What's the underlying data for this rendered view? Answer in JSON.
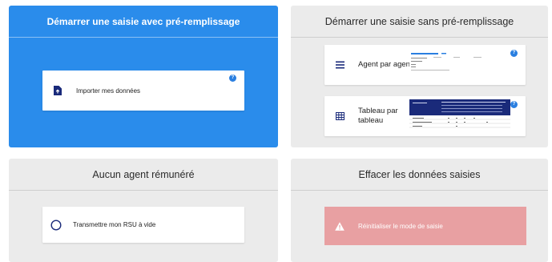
{
  "cards": {
    "with_prefill": {
      "title": "Démarrer une saisie avec pré-remplissage",
      "import_label": "Importer mes données",
      "help": "?"
    },
    "without_prefill": {
      "title": "Démarrer une saisie sans pré-remplissage",
      "agent_label": "Agent par agent",
      "table_label": "Tableau par tableau",
      "help": "?"
    },
    "no_agent": {
      "title": "Aucun agent rémunéré",
      "transmit_label": "Transmettre mon RSU à vide"
    },
    "erase": {
      "title": "Effacer les données saisies",
      "reset_label": "Réinitialiser le mode de saisie"
    }
  },
  "icons": {
    "import": "file-upload-icon",
    "agent": "list-icon",
    "table": "grid-icon",
    "transmit": "radio-circle-icon",
    "warning": "warning-icon"
  },
  "colors": {
    "blue_card": "#2a8ceb",
    "grey_card": "#ebebeb",
    "accent": "#2a7fe0",
    "navy": "#1a2a7a",
    "reset_bg": "#e8a0a2"
  }
}
